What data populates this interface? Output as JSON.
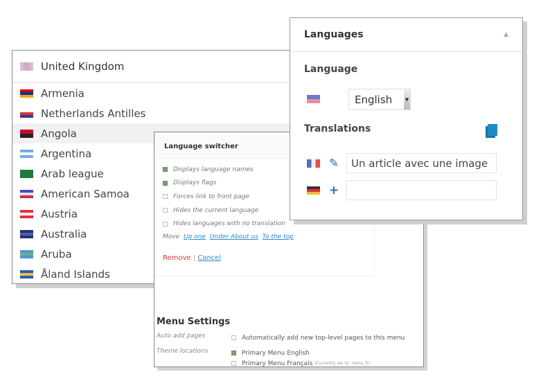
{
  "country_list": {
    "selected": {
      "name": "United Kingdom",
      "flag": [
        "#cf142b",
        "#e8e8f8",
        "#4a55a8"
      ]
    },
    "items": [
      {
        "name": "Armenia",
        "flag": [
          "#d90012",
          "#0033a0",
          "#f2a800"
        ]
      },
      {
        "name": "Netherlands Antilles",
        "flag": [
          "#ffffff",
          "#d33",
          "#2a3f9a"
        ]
      },
      {
        "name": "Angola",
        "flag": [
          "#cc092f",
          "#222222"
        ],
        "highlighted": true
      },
      {
        "name": "Argentina",
        "flag": [
          "#74acdf",
          "#ffffff",
          "#74acdf"
        ]
      },
      {
        "name": "Arab league",
        "flag": [
          "#1e7a3c",
          "#1e7a3c",
          "#1e7a3c"
        ]
      },
      {
        "name": "American Samoa",
        "flag": [
          "#4a4ac8",
          "#e8e0f0",
          "#c8324a"
        ]
      },
      {
        "name": "Austria",
        "flag": [
          "#ed2939",
          "#ffffff",
          "#ed2939"
        ]
      },
      {
        "name": "Australia",
        "flag": [
          "#23347a",
          "#5060a8",
          "#23347a"
        ]
      },
      {
        "name": "Aruba",
        "flag": [
          "#4a9ac8",
          "#6aa8a0",
          "#4a9ac8"
        ]
      },
      {
        "name": "Åland Islands",
        "flag": [
          "#2a5ab8",
          "#e8c040",
          "#2a5ab8"
        ]
      }
    ]
  },
  "switcher": {
    "title": "Language switcher",
    "options": [
      {
        "label": "Displays language names",
        "checked": true
      },
      {
        "label": "Displays flags",
        "checked": true
      },
      {
        "label": "Forces link to front page",
        "checked": false
      },
      {
        "label": "Hides the current language",
        "checked": false
      },
      {
        "label": "Hides languages with no translation",
        "checked": false
      }
    ],
    "move_label": "Move",
    "move_links": [
      "Up one",
      "Under About us",
      "To the top"
    ],
    "remove": "Remove",
    "sep": "|",
    "cancel": "Cancel",
    "menu_settings": {
      "title": "Menu Settings",
      "auto_label": "Auto add pages",
      "auto_text": "Automatically add new top-level pages to this menu",
      "auto_checked": false,
      "theme_label": "Theme locations",
      "loc1": "Primary Menu English",
      "loc1_checked": true,
      "loc2": "Primary Menu Français",
      "loc2_note": "(Currently set to: menu_fr)",
      "loc2_checked": false
    }
  },
  "languages": {
    "title": "Languages",
    "collapse_icon": "triangle-up",
    "language_label": "Language",
    "language_value": "English",
    "translations_label": "Translations",
    "copy_icon": "duplicate",
    "fr_value": "Un article avec une image",
    "fr_icon": "pencil",
    "de_value": "",
    "de_icon": "plus"
  }
}
